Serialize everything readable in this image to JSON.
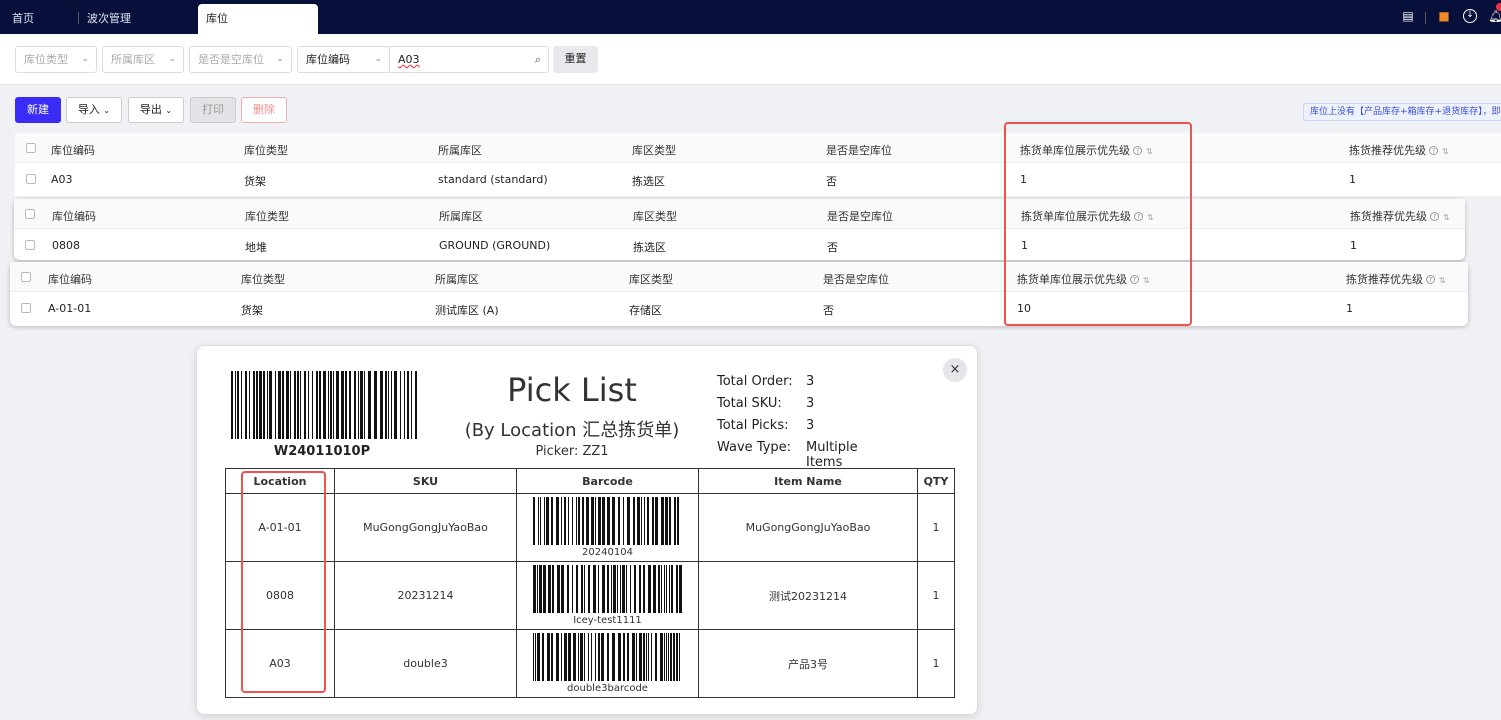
{
  "topbar": {
    "tabs": [
      {
        "label": "首页"
      },
      {
        "label": "波次管理"
      },
      {
        "label": "库位"
      }
    ],
    "icons": [
      "inbox-icon",
      "robot-icon",
      "download-icon",
      "bell-icon"
    ]
  },
  "filters": {
    "location_type": "库位类型",
    "zone": "所属库区",
    "is_empty": "是否是空库位",
    "field": "库位编码",
    "search_value": "A03",
    "reset": "重置"
  },
  "toolbar": {
    "new": "新建",
    "import": "导入",
    "export": "导出",
    "print": "打印",
    "delete": "删除",
    "note": "库位上没有【产品库存+箱库存+退货库存】，即"
  },
  "table": {
    "headers": [
      "库位编码",
      "库位类型",
      "所属库区",
      "库区类型",
      "是否是空库位",
      "拣货单库位展示优先级",
      "拣货推荐优先级"
    ],
    "rows": [
      [
        "A03",
        "货架",
        "standard (standard)",
        "拣选区",
        "否",
        "1",
        "1"
      ],
      [
        "0808",
        "地堆",
        "GROUND (GROUND)",
        "拣选区",
        "否",
        "1",
        "1"
      ],
      [
        "A-01-01",
        "货架",
        "测试库区 (A)",
        "存储区",
        "否",
        "10",
        "1"
      ]
    ]
  },
  "picklist": {
    "wave_code": "W24011010P",
    "title": "Pick List",
    "subtitle": "(By Location 汇总拣货单)",
    "picker": "Picker: ZZ1",
    "stats": [
      {
        "label": "Total Order:",
        "value": "3"
      },
      {
        "label": "Total SKU:",
        "value": "3"
      },
      {
        "label": "Total Picks:",
        "value": "3"
      },
      {
        "label": "Wave Type:",
        "value": "Multiple Items"
      }
    ],
    "headers": [
      "Location",
      "SKU",
      "Barcode",
      "Item Name",
      "QTY"
    ],
    "rows": [
      {
        "location": "A-01-01",
        "sku": "MuGongGongJuYaoBao",
        "barcode": "20240104",
        "item": "MuGongGongJuYaoBao",
        "qty": "1"
      },
      {
        "location": "0808",
        "sku": "20231214",
        "barcode": "Icey-test1111",
        "item": "测试20231214",
        "qty": "1"
      },
      {
        "location": "A03",
        "sku": "double3",
        "barcode": "double3barcode",
        "item": "产品3号",
        "qty": "1"
      }
    ],
    "close": "×"
  },
  "colors": {
    "topbar": "#06103a",
    "primary": "#3a2cf5",
    "highlight": "#f0524f"
  }
}
